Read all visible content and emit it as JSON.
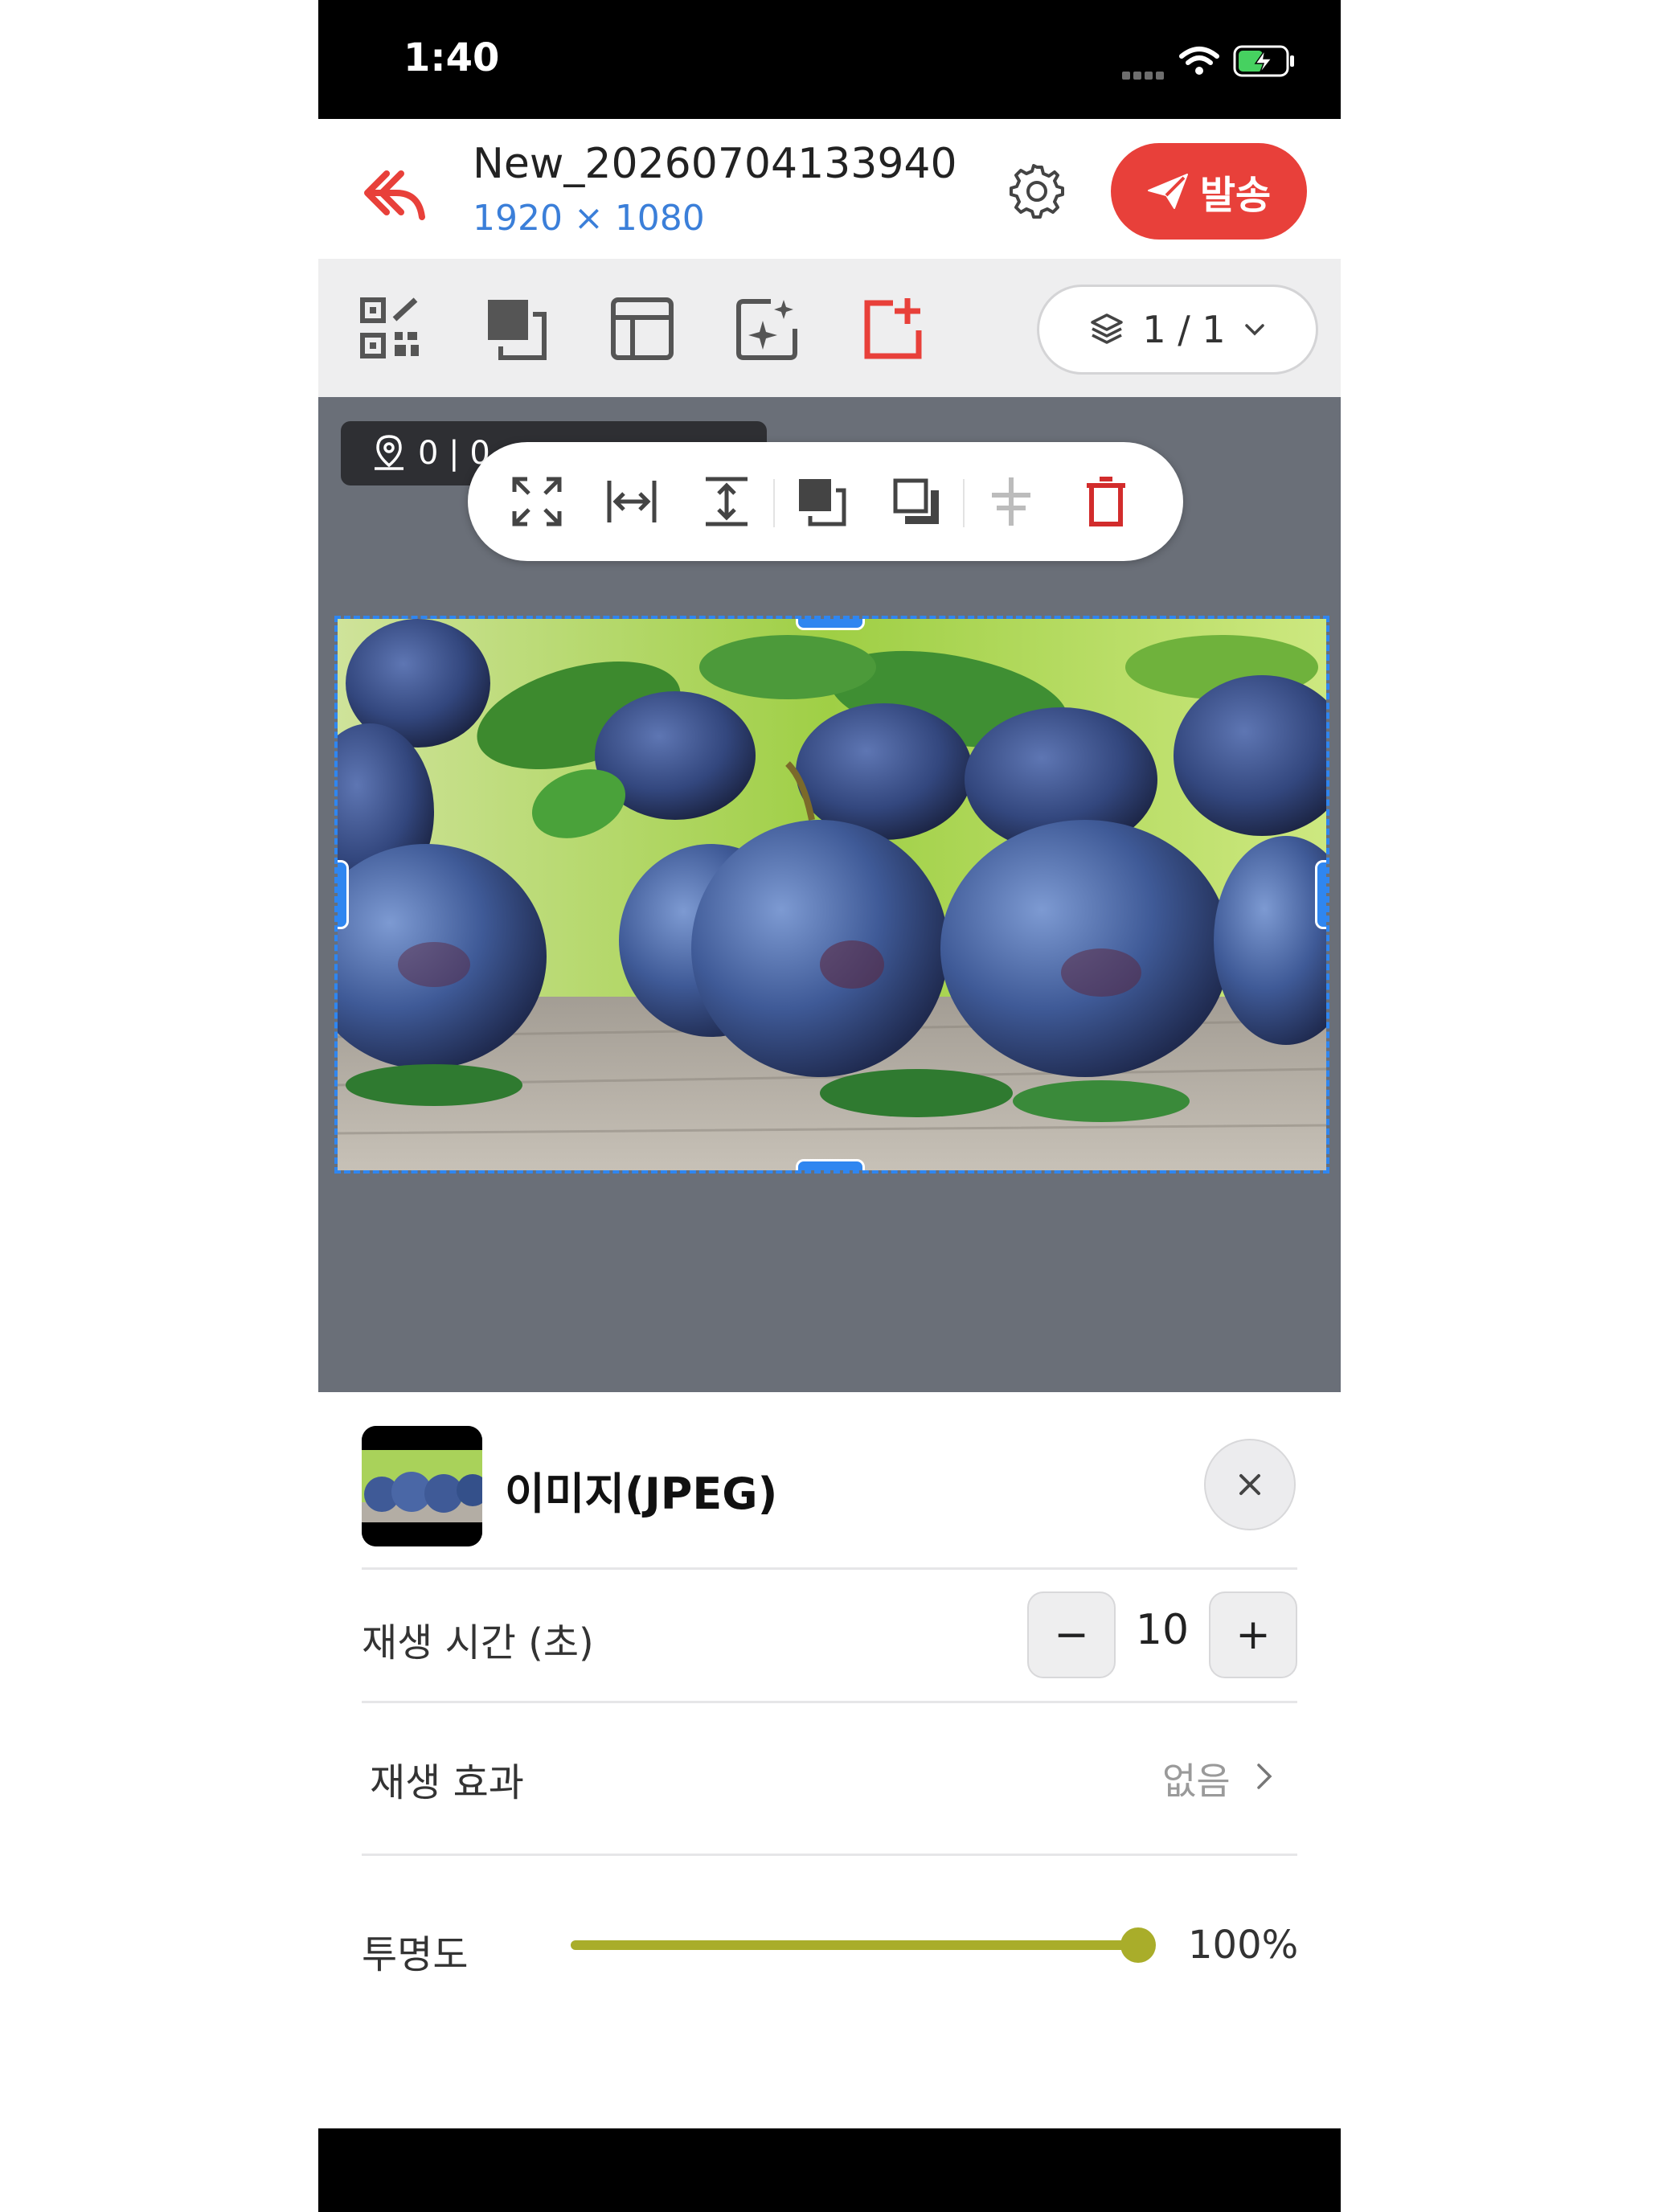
{
  "status_bar": {
    "time": "1:40"
  },
  "header": {
    "title": "New_20260704133940",
    "size_label": "1920 × 1080",
    "send_label": "발송",
    "accent_color": "#e8403a",
    "size_color": "#3b7fd9"
  },
  "toolbar": {
    "tools": [
      "qr-code-icon",
      "layer-stack-icon",
      "layout-icon",
      "ai-sparkle-icon",
      "add-page-icon"
    ],
    "page_indicator": "1 / 1"
  },
  "canvas": {
    "position_badge": "0 | 0",
    "float_tools": [
      "fullscreen-icon",
      "fit-width-icon",
      "fit-height-icon",
      "bring-forward-icon",
      "send-backward-icon",
      "align-center-icon",
      "trash-icon"
    ],
    "selection_color": "#2f86f0",
    "background": "#6a6f78"
  },
  "panel": {
    "item_title": "이미지(JPEG)",
    "duration": {
      "label": "재생 시간 (초)",
      "value": "10",
      "minus": "−",
      "plus": "+"
    },
    "effect": {
      "label": "재생 효과",
      "value": "없음"
    },
    "opacity": {
      "label": "투명도",
      "value_text": "100%",
      "value": 1.0,
      "color": "#a9ad2a"
    }
  }
}
